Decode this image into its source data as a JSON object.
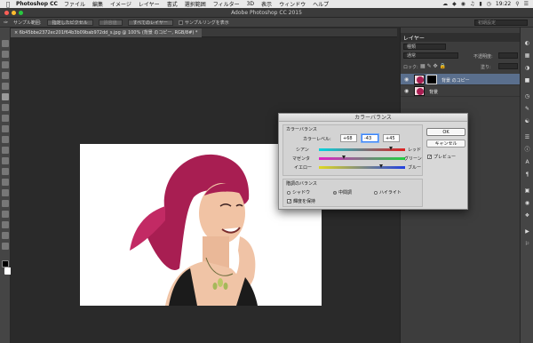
{
  "menubar": {
    "app": "Photoshop CC",
    "items": [
      "ファイル",
      "編集",
      "イメージ",
      "レイヤー",
      "書式",
      "選択範囲",
      "フィルター",
      "3D",
      "表示",
      "ウィンドウ",
      "ヘルプ"
    ],
    "clock": "19:22"
  },
  "window": {
    "title": "Adobe Photoshop CC 2015"
  },
  "options": {
    "sample_size_label": "サンプル範囲:",
    "sample_size_value": "指定したピクセル",
    "tolerance_label": "許容値",
    "all_layers": "すべてのレイヤー",
    "show_sampling_ring": "サンプルリングを表示",
    "workspace": "初期設定"
  },
  "document": {
    "tab_label": "6b45bbe2372ec201f64b3b09bab972dd_s.jpg @ 100% (背景 のコピー, RGB/8#) *"
  },
  "layers_panel": {
    "tab": "レイヤー",
    "kind_filter": "種類",
    "blend_mode": "通常",
    "opacity_label": "不透明度:",
    "lock_label": "ロック:",
    "fill_label": "塗り:",
    "layers": [
      {
        "name": "背景 のコピー",
        "selected": true
      },
      {
        "name": "背景",
        "selected": false
      }
    ]
  },
  "dialog": {
    "title": "カラーバランス",
    "color_balance_group": "カラーバランス",
    "color_levels_label": "カラーレベル:",
    "levels": [
      "+68",
      "-43",
      "+45"
    ],
    "sliders": [
      {
        "left": "シアン",
        "right": "レッド",
        "value": 68
      },
      {
        "left": "マゼンタ",
        "right": "グリーン",
        "value": -43
      },
      {
        "left": "イエロー",
        "right": "ブルー",
        "value": 45
      }
    ],
    "tone_group": "階調のバランス",
    "tones": [
      "シャドウ",
      "中間調",
      "ハイライト"
    ],
    "selected_tone": "中間調",
    "preserve_luminosity": "輝度を保持",
    "ok": "OK",
    "cancel": "キャンセル",
    "preview": "プレビュー"
  }
}
